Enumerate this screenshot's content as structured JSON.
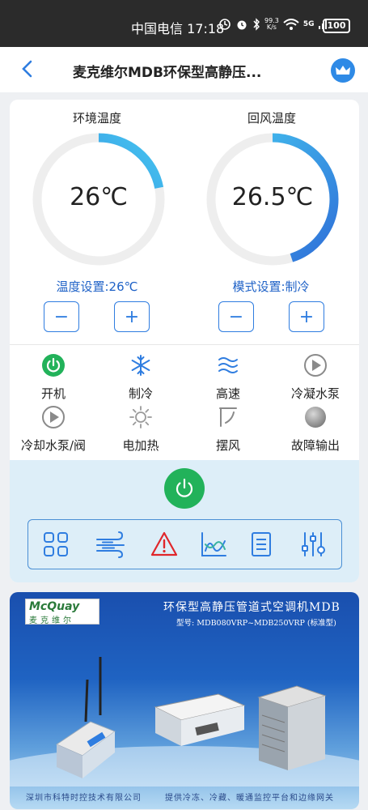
{
  "status_bar": {
    "carrier_time": "中国电信 17:18",
    "net_speed_top": "99.3",
    "net_speed_bottom": "K/s",
    "signal": "5G",
    "battery": "100"
  },
  "header": {
    "title": "麦克维尔MDB环保型高静压..."
  },
  "gauges": [
    {
      "label": "环境温度",
      "value": "26℃",
      "fill": 0.22
    },
    {
      "label": "回风温度",
      "value": "26.5℃",
      "fill": 0.45
    }
  ],
  "settings": {
    "temp_setting": "温度设置:26℃",
    "mode_setting": "模式设置:制冷",
    "minus": "−",
    "plus": "+"
  },
  "status_items": [
    {
      "label": "开机",
      "icon": "power-on-icon"
    },
    {
      "label": "制冷",
      "icon": "snowflake-icon"
    },
    {
      "label": "高速",
      "icon": "wind-speed-icon"
    },
    {
      "label": "冷凝水泵",
      "icon": "pump-play-icon"
    },
    {
      "label": "冷却水泵/阀",
      "icon": "pump-play-icon"
    },
    {
      "label": "电加热",
      "icon": "sun-heater-icon"
    },
    {
      "label": "摆风",
      "icon": "swing-icon"
    },
    {
      "label": "故障输出",
      "icon": "fault-dot-icon"
    }
  ],
  "colors": {
    "accent": "#2f7de0",
    "power_green": "#22b25a",
    "alert_red": "#e0262b",
    "control_bg": "#ddeef8"
  },
  "banner": {
    "logo": "McQuay",
    "logo_sub": "麦克维尔",
    "title": "环保型高静压管道式空调机MDB",
    "model": "型号: MDB080VRP~MDB250VRP (标准型)",
    "footer_left": "深圳市科特时控技术有限公司",
    "footer_right": "提供冷冻、冷藏、暖通监控平台和边缘网关"
  }
}
